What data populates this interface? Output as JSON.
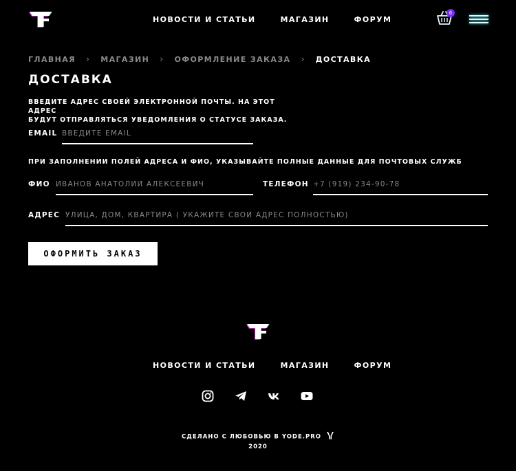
{
  "header": {
    "logo_alt": "TF",
    "nav": [
      {
        "label": "Новости и статьи"
      },
      {
        "label": "Магазин"
      },
      {
        "label": "Форум"
      }
    ],
    "cart_icon": "basket-icon",
    "cart_count": "6",
    "menu_icon": "hamburger-menu-icon"
  },
  "breadcrumb": [
    {
      "label": "Главная"
    },
    {
      "label": "Магазин"
    },
    {
      "label": "Оформление заказа"
    },
    {
      "label": "Доставка"
    }
  ],
  "breadcrumb_separator": "›",
  "page_title": "Доставка",
  "intro_line1": "Введите адрес своей электронной почты. На этот адрес",
  "intro_line2": "будут отправляться уведомления о статусе заказа.",
  "email": {
    "label": "Email",
    "placeholder": "Введите email",
    "value": ""
  },
  "note": "При заполнении полей адреса и ФИО, указывайте полные данные для почтовых служб",
  "fio": {
    "label": "ФИО",
    "placeholder": "Иванов Анатолий Алексеевич",
    "value": ""
  },
  "phone": {
    "label": "Телефон",
    "placeholder": "+7 (919) 234-90-78",
    "value": ""
  },
  "address": {
    "label": "Адрес",
    "placeholder": "Улица, дом, квартира ( укажите свой адрес полностью)",
    "value": ""
  },
  "submit_label": "Оформить заказ",
  "footer": {
    "nav": [
      {
        "label": "Новости и статьи"
      },
      {
        "label": "Магазин"
      },
      {
        "label": "Форум"
      }
    ],
    "socials": [
      "instagram-icon",
      "telegram-icon",
      "vk-icon",
      "youtube-icon"
    ],
    "credit": "Сделано с любовью в yode.pro",
    "year": "2020"
  },
  "colors": {
    "background": "#000000",
    "text": "#ffffff",
    "muted": "#8a8a8a",
    "accent_pink": "#ff3df0",
    "accent_cyan": "#4cf0ff",
    "badge": "#7b2cff"
  }
}
